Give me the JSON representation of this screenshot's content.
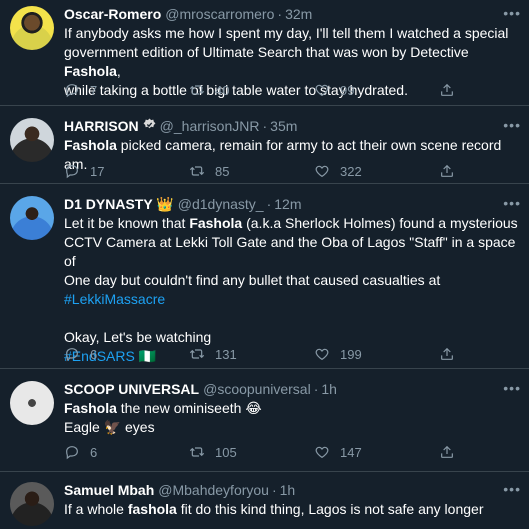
{
  "tweets": [
    {
      "name": "Oscar-Romero",
      "handle": "@mroscarromero",
      "time": "32m",
      "verified": false,
      "lines": [
        [
          "If anybody asks me how I spent my day, I'll tell them I watched a special"
        ],
        [
          "government edition of Ultimate Search that was won by Detective ",
          {
            "b": "Fashola"
          },
          ","
        ],
        [
          "while taking a bottle of bigi table water to stay hydrated."
        ]
      ],
      "replies": "7",
      "retweets": "40",
      "likes": "99"
    },
    {
      "name": "HARRISON",
      "handle": "@_harrisonJNR",
      "time": "35m",
      "verified": true,
      "lines": [
        [
          {
            "b": "Fashola"
          },
          " picked camera, remain for army to act their own scene record am."
        ]
      ],
      "replies": "17",
      "retweets": "85",
      "likes": "322"
    },
    {
      "name": "D1 DYNASTY 👑",
      "handle": "@d1dynasty_",
      "time": "12m",
      "verified": false,
      "lines": [
        [
          "Let it be known that ",
          {
            "b": "Fashola"
          },
          " (a.k.a Sherlock Holmes) found a mysterious"
        ],
        [
          "CCTV Camera at Lekki Toll Gate and the Oba of Lagos \"Staff\" in a space of"
        ],
        [
          "One day but couldn't find any bullet that caused casualties at"
        ],
        [
          {
            "link": "#LekkiMassacre"
          }
        ],
        [],
        [
          "Okay, Let's be watching"
        ],
        [
          {
            "link": "#EndSARS"
          },
          " 🇳🇬"
        ]
      ],
      "replies": "6",
      "retweets": "131",
      "likes": "199"
    },
    {
      "name": "SCOOP UNIVERSAL",
      "handle": "@scoopuniversal",
      "time": "1h",
      "verified": false,
      "lines": [
        [
          {
            "b": "Fashola"
          },
          " the new ominiseeth 😂"
        ],
        [
          "Eagle 🦅 eyes"
        ]
      ],
      "replies": "6",
      "retweets": "105",
      "likes": "147"
    },
    {
      "name": "Samuel Mbah",
      "handle": "@Mbahdeyforyou",
      "time": "1h",
      "verified": false,
      "lines": [
        [
          "If a whole ",
          {
            "b": "fashola"
          },
          " fit do this kind thing, Lagos is not safe any longer"
        ]
      ],
      "replies": "",
      "retweets": "",
      "likes": ""
    }
  ],
  "icons": {
    "reply": "reply-icon",
    "retweet": "retweet-icon",
    "like": "heart-icon",
    "share": "share-icon",
    "more": "more-options-icon",
    "verified": "verified-badge-icon"
  },
  "colors": {
    "background": "#15202b",
    "divider": "#38444d",
    "muted": "#8899a6",
    "link": "#1da1f2",
    "text": "#ffffff"
  }
}
